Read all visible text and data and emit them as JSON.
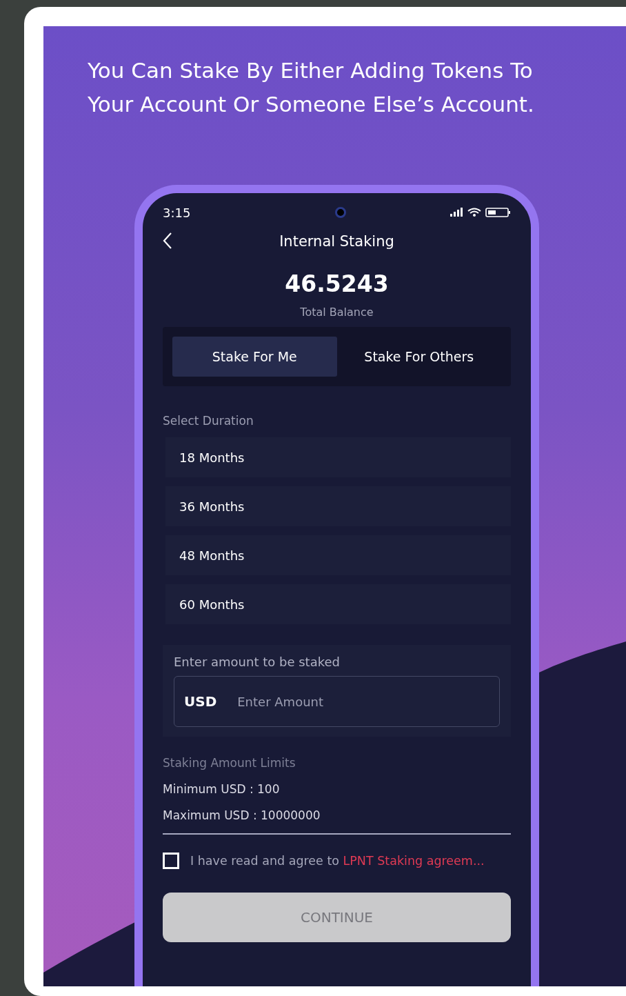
{
  "headline": "You Can Stake By Either Adding Tokens To Your Account Or Someone Else’s Account.",
  "status_bar": {
    "time": "3:15"
  },
  "header": {
    "title": "Internal Staking"
  },
  "balance": {
    "amount": "46.5243",
    "label": "Total Balance"
  },
  "tabs": [
    {
      "label": "Stake For Me",
      "selected": true
    },
    {
      "label": "Stake For Others",
      "selected": false
    }
  ],
  "duration": {
    "label": "Select Duration",
    "options": [
      {
        "label": "18 Months",
        "selected": false
      },
      {
        "label": "36 Months",
        "selected": false
      },
      {
        "label": "48 Months",
        "selected": false
      },
      {
        "label": "60 Months",
        "selected": false
      }
    ]
  },
  "amount": {
    "label": "Enter amount to be staked",
    "currency": "USD",
    "placeholder": "Enter Amount"
  },
  "limits": {
    "title": "Staking Amount Limits",
    "minimum": "Minimum USD : 100",
    "maximum": "Maximum USD : 10000000"
  },
  "agreement": {
    "checked": false,
    "text": "I have read and agree to ",
    "link": "LPNT Staking agreem..."
  },
  "continue_button": {
    "label": "CONTINUE",
    "disabled": true
  }
}
